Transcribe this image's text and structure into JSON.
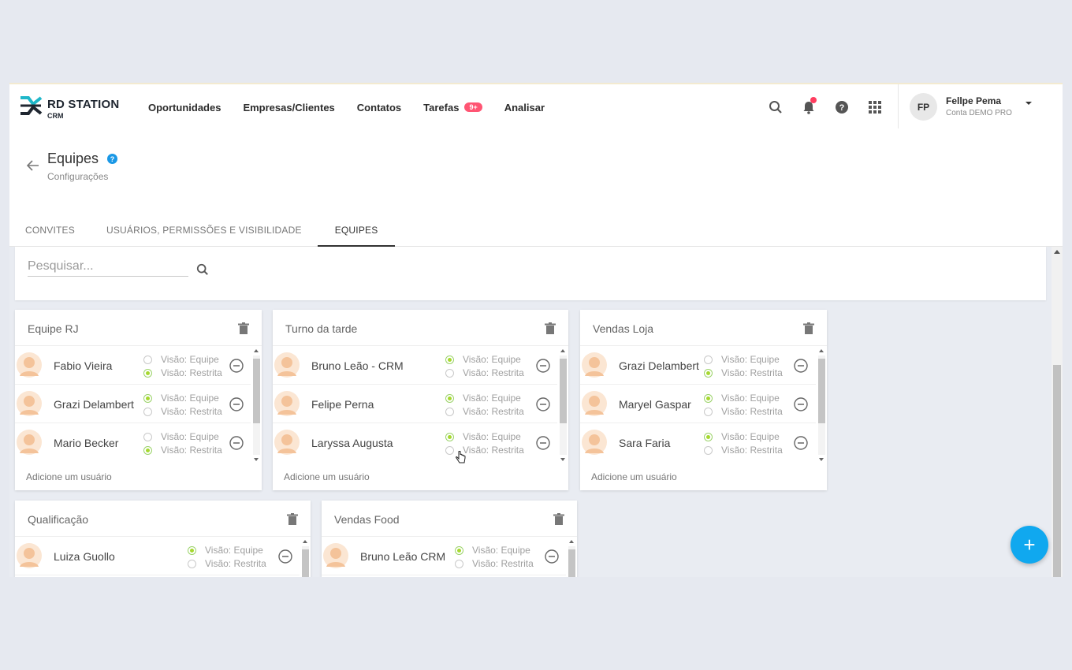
{
  "brand": {
    "name": "RD STATION",
    "product": "CRM"
  },
  "nav": [
    {
      "label": "Oportunidades"
    },
    {
      "label": "Empresas/Clientes"
    },
    {
      "label": "Contatos"
    },
    {
      "label": "Tarefas",
      "badge": "9+"
    },
    {
      "label": "Analisar"
    }
  ],
  "user": {
    "initials": "FP",
    "name": "Fellpe Pema",
    "account": "Conta DEMO PRO"
  },
  "page": {
    "title": "Equipes",
    "help": "?",
    "subtitle": "Configurações"
  },
  "tabs": [
    {
      "label": "CONVITES",
      "active": false
    },
    {
      "label": "USUÁRIOS, PERMISSÕES E VISIBILIDADE",
      "active": false
    },
    {
      "label": "EQUIPES",
      "active": true
    }
  ],
  "search": {
    "placeholder": "Pesquisar..."
  },
  "visibility_labels": {
    "team": "Visão: Equipe",
    "restricted": "Visão: Restrita"
  },
  "add_user_label": "Adicione um usuário",
  "teams": [
    {
      "name": "Equipe RJ",
      "members": [
        {
          "name": "Fabio Vieira",
          "visibility": "restricted"
        },
        {
          "name": "Grazi Delambert",
          "visibility": "team"
        },
        {
          "name": "Mario Becker",
          "visibility": "restricted"
        }
      ]
    },
    {
      "name": "Turno da tarde",
      "members": [
        {
          "name": "Bruno Leão - CRM",
          "visibility": "team"
        },
        {
          "name": "Felipe Perna",
          "visibility": "team"
        },
        {
          "name": "Laryssa Augusta",
          "visibility": "team"
        }
      ]
    },
    {
      "name": "Vendas Loja",
      "members": [
        {
          "name": "Grazi Delambert",
          "visibility": "restricted"
        },
        {
          "name": "Maryel Gaspar",
          "visibility": "team"
        },
        {
          "name": "Sara Faria",
          "visibility": "team"
        }
      ]
    },
    {
      "name": "Qualificação",
      "members": [
        {
          "name": "Luiza Guollo",
          "visibility": "team"
        }
      ]
    },
    {
      "name": "Vendas Food",
      "members": [
        {
          "name": "Bruno Leão  CRM",
          "visibility": "team"
        }
      ]
    }
  ],
  "fab_label": "+",
  "colors": {
    "accent": "#10a8ef",
    "radio_on": "#a6d82f",
    "badge": "#ff5573"
  }
}
